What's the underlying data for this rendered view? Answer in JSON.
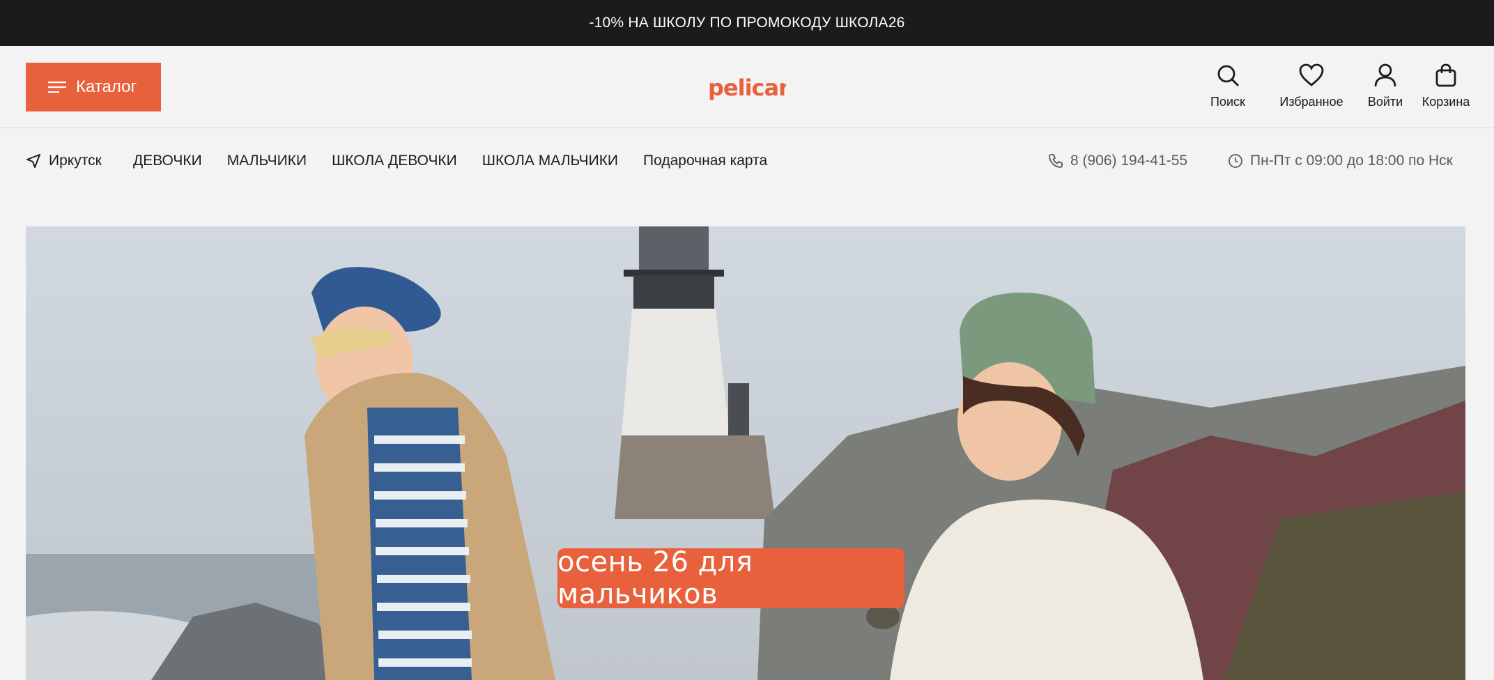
{
  "promo": {
    "text": "-10% НА ШКОЛУ ПО ПРОМОКОДУ ШКОЛА26"
  },
  "header": {
    "catalog_label": "Каталог",
    "logo_text": "pelican",
    "actions": [
      {
        "label": "Поиск",
        "icon": "search-icon"
      },
      {
        "label": "Избранное",
        "icon": "heart-icon"
      },
      {
        "label": "Войти",
        "icon": "user-icon"
      },
      {
        "label": "Корзина",
        "icon": "bag-icon"
      }
    ]
  },
  "nav": {
    "city": "Иркутск",
    "links": [
      "ДЕВОЧКИ",
      "МАЛЬЧИКИ",
      "ШКОЛА ДЕВОЧКИ",
      "ШКОЛА МАЛЬЧИКИ",
      "Подарочная карта"
    ],
    "phone": "8 (906) 194-41-55",
    "hours": "Пн-Пт с 09:00 до 18:00 по Нск"
  },
  "hero": {
    "caption": "осень 26 для мальчиков"
  },
  "colors": {
    "accent": "#e8603c",
    "promo_bg": "#1b1b1b",
    "page_bg": "#f3f3f3"
  }
}
